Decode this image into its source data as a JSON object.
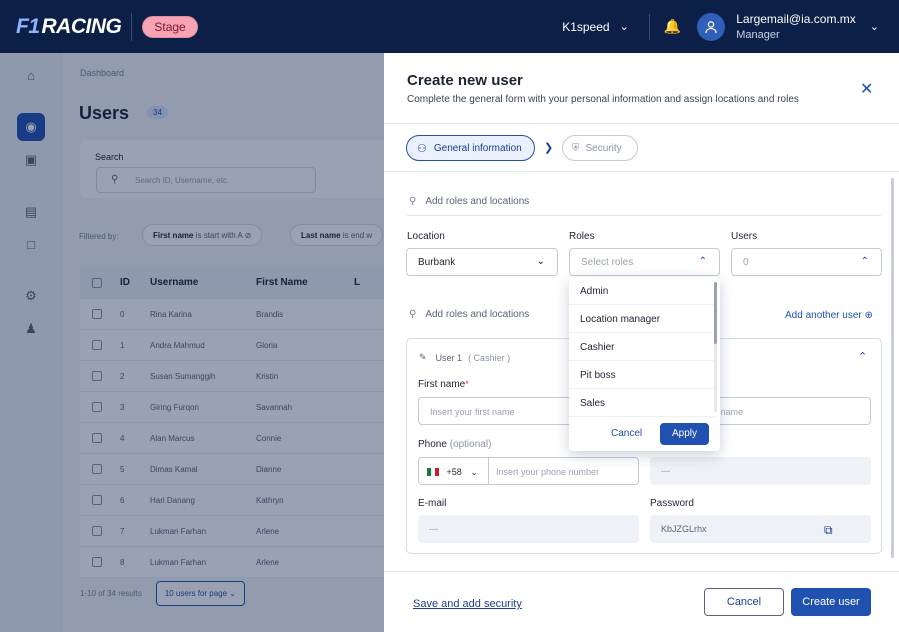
{
  "header": {
    "logo_f1": "F1",
    "logo_text": "RACING",
    "env_badge": "Stage",
    "org": "K1speed",
    "user_email": "Largemail@ia.com.mx",
    "user_role": "Manager"
  },
  "background": {
    "breadcrumb": "Dashboard",
    "title": "Users",
    "count": "34",
    "search_label": "Search",
    "search_placeholder": "Search ID, Username, etc.",
    "filtered_by": "Filtered by:",
    "chips": [
      {
        "field": "First name",
        "rest": "is start with A"
      },
      {
        "field": "Last name",
        "rest": "is end w"
      }
    ],
    "columns": [
      "ID",
      "Username",
      "First Name",
      "L"
    ],
    "rows": [
      {
        "id": "0",
        "username": "Rina Karina",
        "first": "Brandis"
      },
      {
        "id": "1",
        "username": "Andra Mahmud",
        "first": "Gloria"
      },
      {
        "id": "2",
        "username": "Susan Sumanggih",
        "first": "Kristin"
      },
      {
        "id": "3",
        "username": "Giring Furqon",
        "first": "Savannah"
      },
      {
        "id": "4",
        "username": "Alan Marcus",
        "first": "Connie"
      },
      {
        "id": "5",
        "username": "Dimas Kamal",
        "first": "Dianne"
      },
      {
        "id": "6",
        "username": "Hari Danang",
        "first": "Kathryn"
      },
      {
        "id": "7",
        "username": "Lukman Farhan",
        "first": "Arlene"
      },
      {
        "id": "8",
        "username": "Lukman Farhan",
        "first": "Arlene"
      }
    ],
    "pagination": "1-10 of 34 results",
    "per_page": "10 users for page"
  },
  "panel": {
    "title": "Create new user",
    "subtitle": "Complete the general form with your personal information and assign locations and roles",
    "steps": {
      "general": "General information",
      "security": "Security"
    },
    "section1_title": "Add roles and locations",
    "location_label": "Location",
    "location_value": "Burbank",
    "roles_label": "Roles",
    "roles_placeholder": "Select roles",
    "users_label": "Users",
    "users_value": "0",
    "roles_options": [
      "Admin",
      "Location manager",
      "Cashier",
      "Pit boss",
      "Sales"
    ],
    "dd_cancel": "Cancel",
    "dd_apply": "Apply",
    "section2_title": "Add roles and locations",
    "add_another": "Add another user",
    "card": {
      "user_label": "User 1",
      "user_role": "( Cashier )",
      "first_name_label": "First name",
      "first_name_placeholder": "Insert your first name",
      "last_name_placeholder_partial": "st name",
      "phone_label": "Phone",
      "phone_optional": "(optional)",
      "phone_code": "+58",
      "phone_placeholder": "Insert your phone number",
      "phone_right_value": "---",
      "email_label": "E-mail",
      "email_value": "---",
      "password_label": "Password",
      "password_value": "KbJZGLrhx"
    },
    "footer": {
      "save_link": "Save and add security",
      "cancel": "Cancel",
      "create": "Create user"
    }
  }
}
